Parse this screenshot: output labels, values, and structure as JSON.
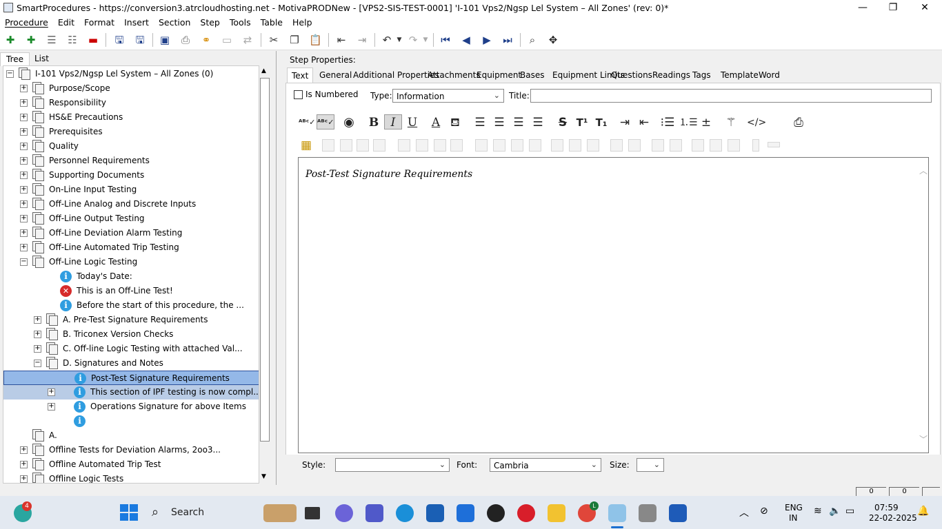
{
  "window": {
    "title": "SmartProcedures - https://conversion3.atrcloudhosting.net - MotivaPRODNew - [VPS2-SIS-TEST-0001] 'I-101 Vps2/Ngsp Lel System – All Zones' (rev: 0)*",
    "minimize": "—",
    "maximize": "❐",
    "close": "✕"
  },
  "menu": [
    "Procedure",
    "Edit",
    "Format",
    "Insert",
    "Section",
    "Step",
    "Tools",
    "Table",
    "Help"
  ],
  "left_tabs": {
    "tree": "Tree",
    "list": "List"
  },
  "tree": {
    "root": "I-101 Vps2/Ngsp Lel System – All Zones (0)",
    "items": [
      {
        "label": "Purpose/Scope"
      },
      {
        "label": "Responsibility"
      },
      {
        "label": "HS&E Precautions"
      },
      {
        "label": "Prerequisites"
      },
      {
        "label": "Quality"
      },
      {
        "label": "Personnel Requirements"
      },
      {
        "label": "Supporting Documents"
      },
      {
        "label": "On-Line Input Testing"
      },
      {
        "label": "Off-Line Analog and Discrete Inputs"
      },
      {
        "label": "Off-Line Output Testing"
      },
      {
        "label": "Off-Line Deviation Alarm Testing"
      },
      {
        "label": "Off-Line Automated Trip Testing"
      },
      {
        "label": "Off-Line Logic Testing"
      },
      {
        "label": "Today's Date:"
      },
      {
        "label": "This is an Off-Line Test!"
      },
      {
        "label": "Before the start of this procedure, the ..."
      },
      {
        "label": "A. Pre-Test Signature Requirements"
      },
      {
        "label": "B. Triconex Version Checks"
      },
      {
        "label": "C. Off-line Logic Testing with attached Val..."
      },
      {
        "label": "D. Signatures and Notes"
      },
      {
        "label": "Post-Test Signature Requirements"
      },
      {
        "label": "This section of IPF testing is now compl..."
      },
      {
        "label": "Operations Signature for above Items"
      },
      {
        "label": ""
      },
      {
        "label": "A."
      },
      {
        "label": "Offline Tests for Deviation Alarms, 2oo3..."
      },
      {
        "label": "Offline Automated Trip Test"
      },
      {
        "label": "Offline Logic Tests"
      }
    ]
  },
  "step_properties": {
    "heading": "Step Properties:",
    "tabs": [
      "Text",
      "General",
      "Additional Properties",
      "Attachments",
      "Equipment",
      "Bases",
      "Equipment Limits",
      "Questions",
      "Readings",
      "Tags",
      "Template",
      "Word"
    ],
    "is_numbered_label": "Is Numbered",
    "type_label": "Type:",
    "type_value": "Information",
    "title_label": "Title:",
    "title_value": "",
    "editor_text": "Post-Test Signature Requirements",
    "style_label": "Style:",
    "style_value": "",
    "font_label": "Font:",
    "font_value": "Cambria",
    "size_label": "Size:",
    "size_value": ""
  },
  "format_toolbar": {
    "bold": "B",
    "italic": "I",
    "underline": "U",
    "font_color": "A",
    "strike": "S",
    "superscript": "T¹",
    "subscript": "T₁",
    "html": "</>"
  },
  "status": {
    "field1": "0",
    "field2": "0"
  },
  "taskbar": {
    "notification_badge": "4",
    "search": "Search",
    "lang1": "ENG",
    "lang2": "IN",
    "time": "07:59",
    "date": "22-02-2025",
    "chrome_badge": "L"
  },
  "colors": {
    "selection": "#94b8e8",
    "selection_border": "#2a4f9a",
    "info": "#2f9de0",
    "error": "#d62b2b",
    "toolbar_icon": "#1f3f8a"
  }
}
